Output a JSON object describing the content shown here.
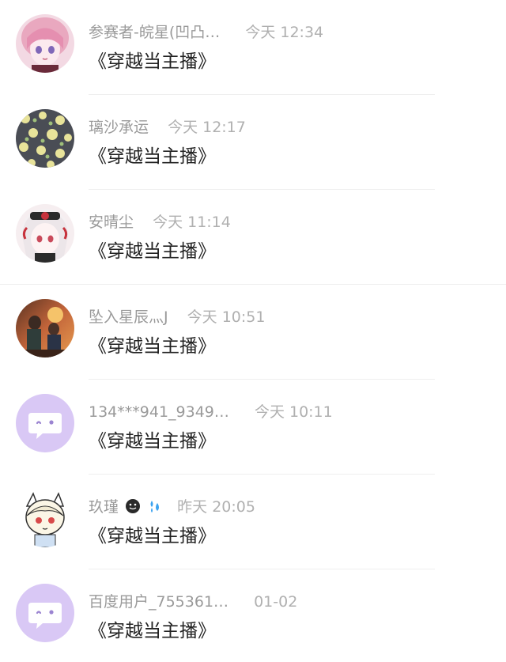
{
  "comments": [
    {
      "name": "参赛者-皖星(凹凸…",
      "time": "今天 12:34",
      "text": "《穿越当主播》",
      "avatar": "anime-pink-hair"
    },
    {
      "name": "璃沙承运",
      "time": "今天 12:17",
      "text": "《穿越当主播》",
      "avatar": "flower-pattern"
    },
    {
      "name": "安晴尘",
      "time": "今天 11:14",
      "text": "《穿越当主播》",
      "avatar": "anime-white-hair"
    },
    {
      "name": "坠入星辰灬J",
      "time": "今天 10:51",
      "text": "《穿越当主播》",
      "avatar": "photo-two-people"
    },
    {
      "name": "134***941_9349…",
      "time": "今天 10:11",
      "text": "《穿越当主播》",
      "avatar": "default-chat-bubble"
    },
    {
      "name": "玖瑾",
      "time": "昨天 20:05",
      "text": "《穿越当主播》",
      "avatar": "anime-cat-ear-girl",
      "emojis": [
        "dark-smiley",
        "sweat-drops"
      ]
    },
    {
      "name": "百度用户_755361…",
      "time": "01-02",
      "text": "《穿越当主播》",
      "avatar": "default-chat-bubble"
    }
  ],
  "colors": {
    "default_avatar_bg": "#d9c8f5",
    "name_text": "#9a9a9a",
    "content_text": "#222222"
  }
}
